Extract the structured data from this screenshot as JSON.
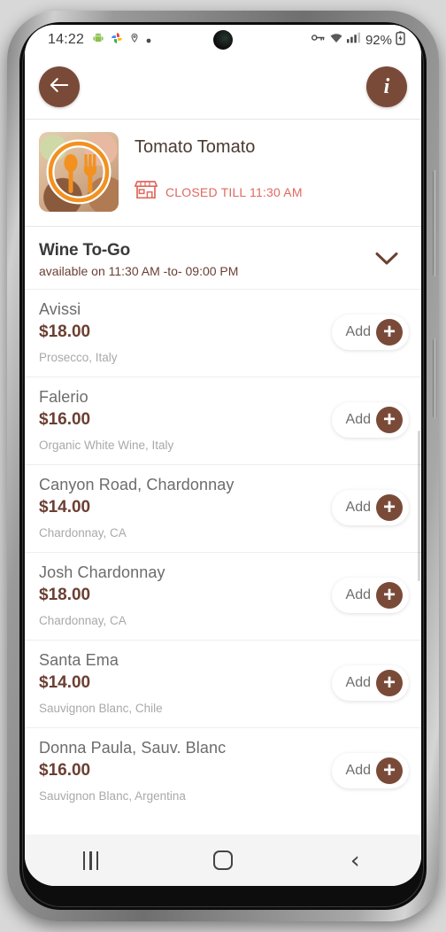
{
  "status_bar": {
    "time": "14:22",
    "left_icons": [
      "android-icon",
      "photos-icon",
      "location-pin-icon",
      "dot-icon"
    ],
    "right_icons": [
      "vpn-key-icon",
      "wifi-icon",
      "signal-icon"
    ],
    "battery_percent": "92%",
    "battery_icon": "battery-charging-icon"
  },
  "topbar": {
    "back_icon": "back-arrow-icon",
    "info_icon": "info-icon",
    "info_label": "i"
  },
  "restaurant": {
    "logo_icon": "spoon-fork-logo-icon",
    "name": "Tomato Tomato",
    "status_icon": "storefront-icon",
    "status_text": "CLOSED TILL 11:30 AM",
    "status_color": "#e0685d"
  },
  "category": {
    "title": "Wine To-Go",
    "subtitle": "available on 11:30 AM -to- 09:00 PM",
    "expand_icon": "chevron-down-icon"
  },
  "add_button": {
    "label": "Add",
    "icon": "plus-icon"
  },
  "menu_items": [
    {
      "name": "Avissi",
      "price": "$18.00",
      "description": "Prosecco, Italy"
    },
    {
      "name": "Falerio",
      "price": "$16.00",
      "description": "Organic White Wine, Italy"
    },
    {
      "name": "Canyon Road, Chardonnay",
      "price": "$14.00",
      "description": "Chardonnay, CA"
    },
    {
      "name": "Josh Chardonnay",
      "price": "$18.00",
      "description": "Chardonnay, CA"
    },
    {
      "name": "Santa Ema",
      "price": "$14.00",
      "description": "Sauvignon Blanc, Chile"
    },
    {
      "name": "Donna Paula,  Sauv. Blanc",
      "price": "$16.00",
      "description": "Sauvignon Blanc, Argentina"
    }
  ],
  "nav_bar": {
    "recents_icon": "recents-icon",
    "home_icon": "home-icon",
    "back_icon": "back-icon"
  },
  "theme": {
    "brand_brown": "#7a4a39",
    "price_brown": "#6b3f32",
    "logo_orange": "#f2911f",
    "closed_red": "#e0685d"
  }
}
